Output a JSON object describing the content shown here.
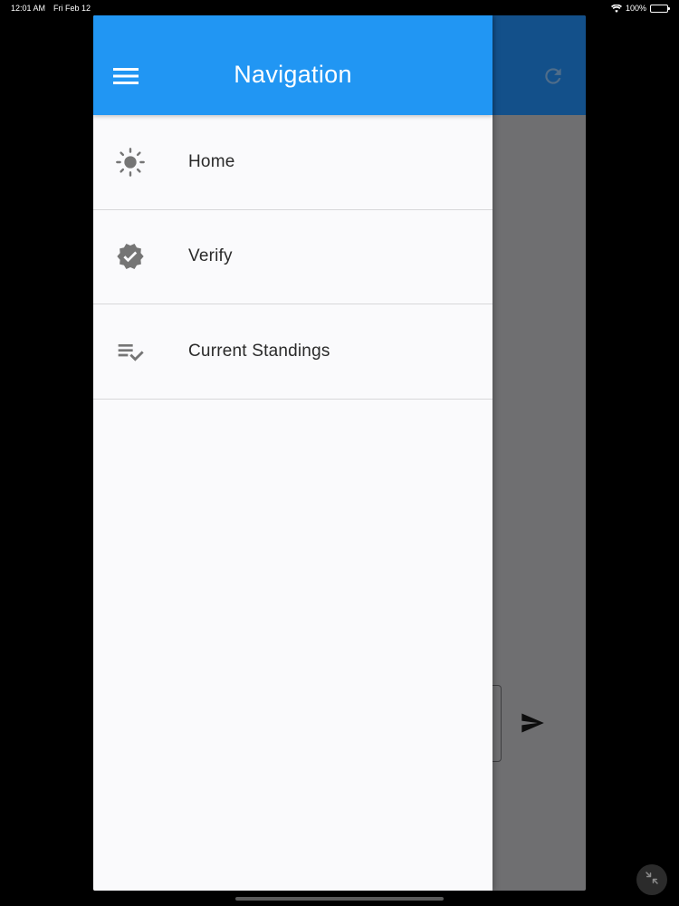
{
  "status_bar": {
    "time": "12:01 AM",
    "date": "Fri Feb 12",
    "battery": "100%"
  },
  "drawer": {
    "title": "Navigation",
    "items": [
      {
        "label": "Home",
        "icon": "sun-icon"
      },
      {
        "label": "Verify",
        "icon": "verified-badge-icon"
      },
      {
        "label": "Current Standings",
        "icon": "playlist-check-icon"
      }
    ]
  },
  "colors": {
    "header": "#2196f3",
    "app_bar_behind": "#13508a",
    "scrim": "#6f6f71",
    "drawer_bg": "#fafafc",
    "icon_grey": "#757575"
  }
}
